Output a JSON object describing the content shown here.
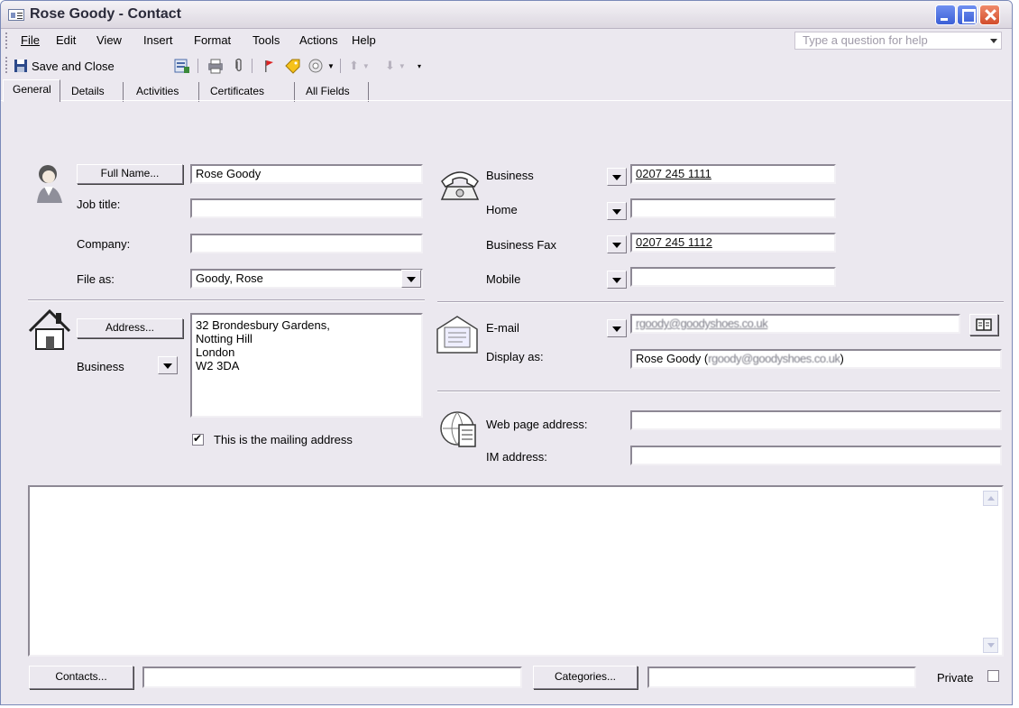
{
  "window": {
    "title": "Rose Goody - Contact"
  },
  "menu": {
    "items": [
      {
        "label": "File"
      },
      {
        "label": "Edit"
      },
      {
        "label": "View"
      },
      {
        "label": "Insert"
      },
      {
        "label": "Format"
      },
      {
        "label": "Tools"
      },
      {
        "label": "Actions"
      },
      {
        "label": "Help"
      }
    ],
    "help_placeholder": "Type a question for help"
  },
  "toolbar": {
    "save_close": "Save and Close"
  },
  "tabs": [
    {
      "label": "General",
      "active": true
    },
    {
      "label": "Details"
    },
    {
      "label": "Activities"
    },
    {
      "label": "Certificates"
    },
    {
      "label": "All Fields"
    }
  ],
  "general": {
    "full_name_button": "Full Name...",
    "full_name": "Rose Goody",
    "job_title_label": "Job title:",
    "job_title": "",
    "company_label": "Company:",
    "company": "",
    "file_as_label": "File as:",
    "file_as": "Goody, Rose",
    "address_button": "Address...",
    "address_type": "Business",
    "address_lines": "32  Brondesbury Gardens,\nNotting Hill\nLondon\nW2 3DA",
    "mailing_address_label": "This is the mailing address",
    "mailing_address_checked": true
  },
  "phones": [
    {
      "label": "Business",
      "value": "0207 245 1111"
    },
    {
      "label": "Home",
      "value": ""
    },
    {
      "label": "Business Fax",
      "value": "0207 245 1112"
    },
    {
      "label": "Mobile",
      "value": ""
    }
  ],
  "email": {
    "label": "E-mail",
    "value": "rgoody@goodyshoes.co.uk",
    "display_as_label": "Display as:",
    "display_as_prefix": "Rose Goody (",
    "display_as_blurred": "rgoody@goodyshoes.co.uk",
    "display_as_suffix": ")"
  },
  "web": {
    "web_label": "Web page address:",
    "web_value": "",
    "im_label": "IM address:",
    "im_value": ""
  },
  "footer": {
    "contacts_button": "Contacts...",
    "contacts_value": "",
    "categories_button": "Categories...",
    "categories_value": "",
    "private_label": "Private",
    "private_checked": false
  }
}
